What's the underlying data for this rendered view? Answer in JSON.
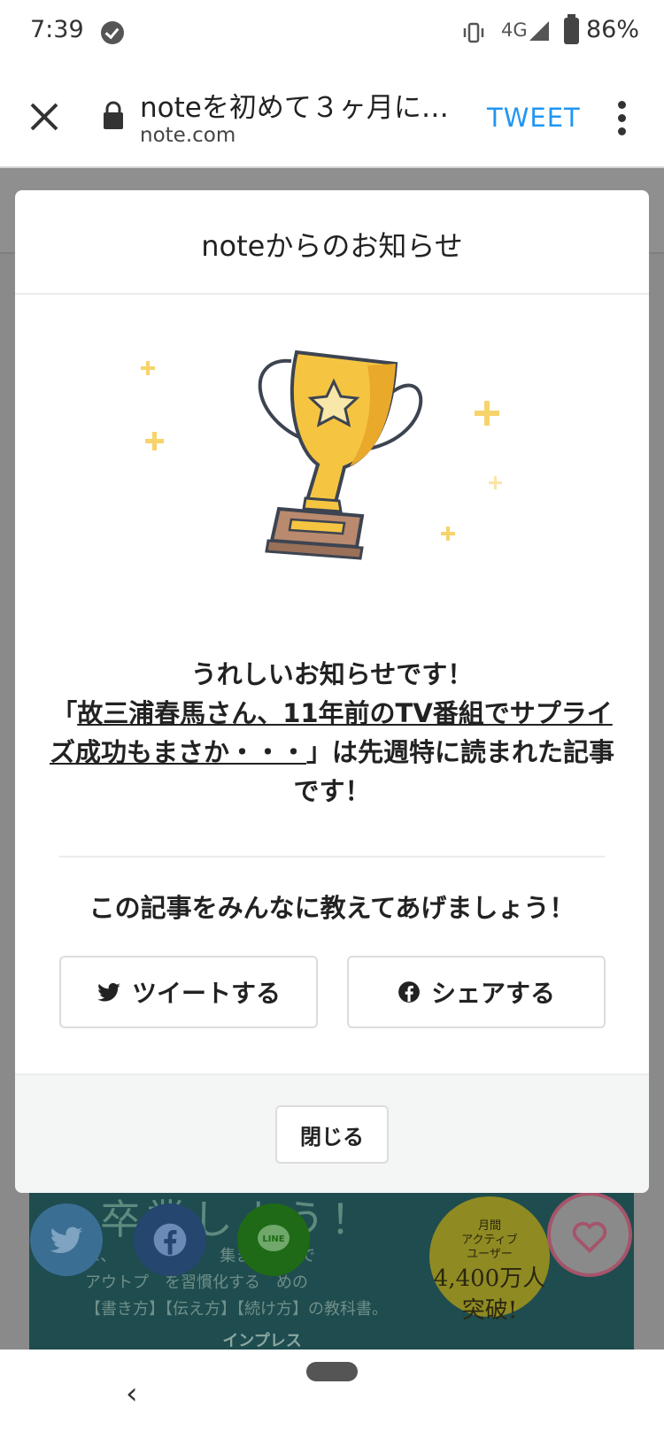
{
  "status_bar": {
    "time": "7:39",
    "network": "4G",
    "battery": "86%"
  },
  "browser": {
    "page_title": "noteを初めて３ヶ月に…",
    "domain": "note.com",
    "tweet_label": "TWEET"
  },
  "modal": {
    "title": "noteからのお知らせ",
    "message_intro": "うれしいお知らせです！",
    "open_quote": "「",
    "article_title": "故三浦春馬さん、11年前のTV番組でサプライズ成功もまさか・・・",
    "message_suffix": "」は先週特に読まれた記事です！",
    "share_prompt": "この記事をみんなに教えてあげましょう！",
    "tweet_button": "ツイートする",
    "share_button": "シェアする",
    "close_button": "閉じる"
  },
  "background_page": {
    "book_line1": "ま、　　量の　　　集まる場所で",
    "book_line2": "アウトプ　を習慣化する　めの",
    "book_line3": "【書き方】【伝え方】【続け方】の教科書。",
    "publisher": "インプレス",
    "badge_line1": "月間",
    "badge_line2": "アクティブ",
    "badge_line3": "ユーザー",
    "badge_number": "4,400万人",
    "badge_suffix": "突破!"
  },
  "share_fabs": {
    "line_label": "LINE"
  },
  "colors": {
    "accent_blue": "#2196f3",
    "trophy_gold": "#f5c542",
    "sparkle": "#f7d36b"
  }
}
